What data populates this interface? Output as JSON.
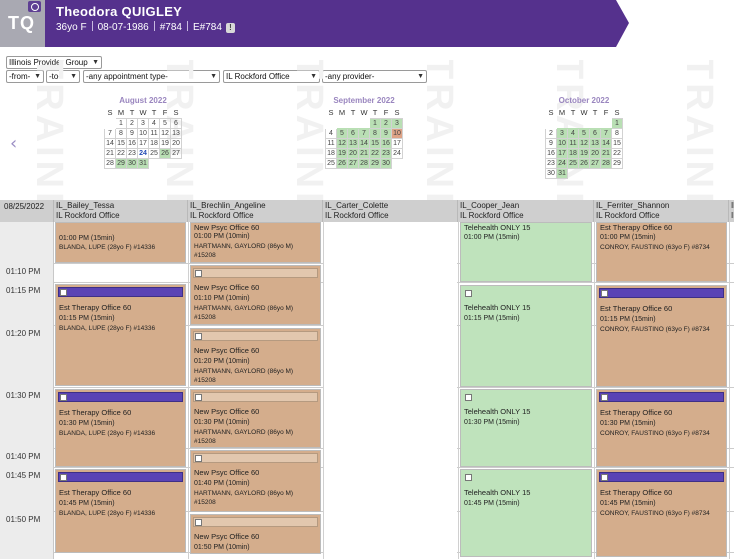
{
  "header": {
    "initials": "TQ",
    "patient_name": "Theodora QUIGLEY",
    "age_sex": "36yo F",
    "dob": "08-07-1986",
    "chart_no": "#784",
    "e_no": "E#784",
    "alert_badge": "!",
    "colors": {
      "band": "#55318d",
      "avatar": "#a9a9b2"
    },
    "icons": [
      "camera-icon",
      "alert-icon"
    ]
  },
  "filters": {
    "group": "Illinois Provider Group",
    "from": "-from-",
    "to": "-to-",
    "appointment_type": "-any appointment type-",
    "office": "IL Rockford Office",
    "provider": "-any provider-"
  },
  "watermark": [
    "TRAINING",
    "TRAINING",
    "TRAINING",
    "TRAINING",
    "TRAINING",
    "TRAINING"
  ],
  "calendars": [
    {
      "title": "August 2022",
      "dow": [
        "S",
        "M",
        "T",
        "W",
        "T",
        "F",
        "S"
      ],
      "weeks": [
        [
          "",
          "1",
          "2",
          "3",
          "4",
          "5",
          "6"
        ],
        [
          "7",
          "8",
          "9",
          "10",
          "11",
          "12",
          "13"
        ],
        [
          "14",
          "15",
          "16",
          "17",
          "18",
          "19",
          "20"
        ],
        [
          "21",
          "22",
          "23",
          "24",
          "25",
          "26",
          "27"
        ],
        [
          "28",
          "29",
          "30",
          "31",
          "",
          "",
          ""
        ]
      ],
      "available_days": [
        "26",
        "29",
        "30",
        "31"
      ],
      "today": "24"
    },
    {
      "title": "September 2022",
      "dow": [
        "S",
        "M",
        "T",
        "W",
        "T",
        "F",
        "S"
      ],
      "weeks": [
        [
          "",
          "",
          "",
          "",
          "1",
          "2",
          "3"
        ],
        [
          "4",
          "5",
          "6",
          "7",
          "8",
          "9",
          "10"
        ],
        [
          "11",
          "12",
          "13",
          "14",
          "15",
          "16",
          "17"
        ],
        [
          "18",
          "19",
          "20",
          "21",
          "22",
          "23",
          "24"
        ],
        [
          "25",
          "26",
          "27",
          "28",
          "29",
          "30",
          ""
        ]
      ],
      "available_days": [
        "1",
        "2",
        "3",
        "5",
        "6",
        "7",
        "8",
        "9",
        "12",
        "13",
        "14",
        "15",
        "16",
        "19",
        "20",
        "21",
        "22",
        "23",
        "26",
        "27",
        "28",
        "29",
        "30"
      ],
      "highlight_days": [
        "10"
      ],
      "today": ""
    },
    {
      "title": "October 2022",
      "dow": [
        "S",
        "M",
        "T",
        "W",
        "T",
        "F",
        "S"
      ],
      "weeks": [
        [
          "",
          "",
          "",
          "",
          "",
          "",
          "1"
        ],
        [
          "2",
          "3",
          "4",
          "5",
          "6",
          "7",
          "8"
        ],
        [
          "9",
          "10",
          "11",
          "12",
          "13",
          "14",
          "15"
        ],
        [
          "16",
          "17",
          "18",
          "19",
          "20",
          "21",
          "22"
        ],
        [
          "23",
          "24",
          "25",
          "26",
          "27",
          "28",
          "29"
        ],
        [
          "30",
          "31",
          "",
          "",
          "",
          "",
          ""
        ]
      ],
      "available_days": [
        "1",
        "3",
        "4",
        "5",
        "6",
        "7",
        "10",
        "11",
        "12",
        "13",
        "14",
        "17",
        "18",
        "19",
        "20",
        "21",
        "24",
        "25",
        "26",
        "27",
        "28",
        "31"
      ],
      "today": ""
    }
  ],
  "schedule": {
    "date": "08/25/2022",
    "columns": [
      {
        "provider": "IL_Bailey_Tessa",
        "office": "IL Rockford Office"
      },
      {
        "provider": "IL_Brechlin_Angeline",
        "office": "IL Rockford Office"
      },
      {
        "provider": "IL_Carter_Colette",
        "office": "IL Rockford Office"
      },
      {
        "provider": "IL_Cooper_Jean",
        "office": "IL Rockford Office"
      },
      {
        "provider": "IL_Ferriter_Shannon",
        "office": "IL Rockford Office"
      },
      {
        "provider": "Il",
        "office": "IL"
      }
    ],
    "times": [
      "01:10 PM",
      "01:15 PM",
      "01:20 PM",
      "01:30 PM",
      "01:40 PM",
      "01:45 PM",
      "01:50 PM"
    ],
    "appointments": {
      "bailey": [
        {
          "type": "",
          "time": "01:00 PM (15min)",
          "patient": "BLANDA, LUPE (28yo F) #14336",
          "extra": ""
        },
        {
          "type": "Est Therapy Office 60",
          "time": "01:15 PM (15min)",
          "patient": "BLANDA, LUPE (28yo F) #14336",
          "extra": ""
        },
        {
          "type": "Est Therapy Office 60",
          "time": "01:30 PM (15min)",
          "patient": "BLANDA, LUPE (28yo F) #14336",
          "extra": ""
        },
        {
          "type": "Est Therapy Office 60",
          "time": "01:45 PM (15min)",
          "patient": "BLANDA, LUPE (28yo F) #14336",
          "extra": ""
        }
      ],
      "brechlin": [
        {
          "type": "New Psyc Office 60",
          "time": "01:00 PM (10min)",
          "patient": "HARTMANN, GAYLORD (86yo M)",
          "extra": "#15208"
        },
        {
          "type": "New Psyc Office 60",
          "time": "01:10 PM (10min)",
          "patient": "HARTMANN, GAYLORD (86yo M)",
          "extra": "#15208"
        },
        {
          "type": "New Psyc Office 60",
          "time": "01:20 PM (10min)",
          "patient": "HARTMANN, GAYLORD (86yo M)",
          "extra": "#15208"
        },
        {
          "type": "New Psyc Office 60",
          "time": "01:30 PM (10min)",
          "patient": "HARTMANN, GAYLORD (86yo M)",
          "extra": "#15208"
        },
        {
          "type": "New Psyc Office 60",
          "time": "01:40 PM (10min)",
          "patient": "HARTMANN, GAYLORD (86yo M)",
          "extra": "#15208"
        },
        {
          "type": "New Psyc Office 60",
          "time": "01:50 PM (10min)",
          "patient": "",
          "extra": ""
        }
      ],
      "cooper": [
        {
          "type": "Telehealth ONLY 15",
          "time": "01:00 PM (15min)"
        },
        {
          "type": "Telehealth ONLY 15",
          "time": "01:15 PM (15min)"
        },
        {
          "type": "Telehealth ONLY 15",
          "time": "01:30 PM (15min)"
        },
        {
          "type": "Telehealth ONLY 15",
          "time": "01:45 PM (15min)"
        }
      ],
      "ferriter": [
        {
          "type": "Est Therapy Office 60",
          "time": "01:00 PM (15min)",
          "patient": "CONROY, FAUSTINO (63yo F) #8734"
        },
        {
          "type": "Est Therapy Office 60",
          "time": "01:15 PM (15min)",
          "patient": "CONROY, FAUSTINO (63yo F) #8734"
        },
        {
          "type": "Est Therapy Office 60",
          "time": "01:30 PM (15min)",
          "patient": "CONROY, FAUSTINO (63yo F) #8734"
        },
        {
          "type": "Est Therapy Office 60",
          "time": "01:45 PM (15min)",
          "patient": "CONROY, FAUSTINO (63yo F) #8734"
        }
      ]
    },
    "colors": {
      "booked": "#d4ad8c",
      "telehealth": "#bfe3bc",
      "status_bar": "#5a43b5",
      "available_day": "#b9dfb4",
      "flagged_day": "#dea386"
    }
  }
}
